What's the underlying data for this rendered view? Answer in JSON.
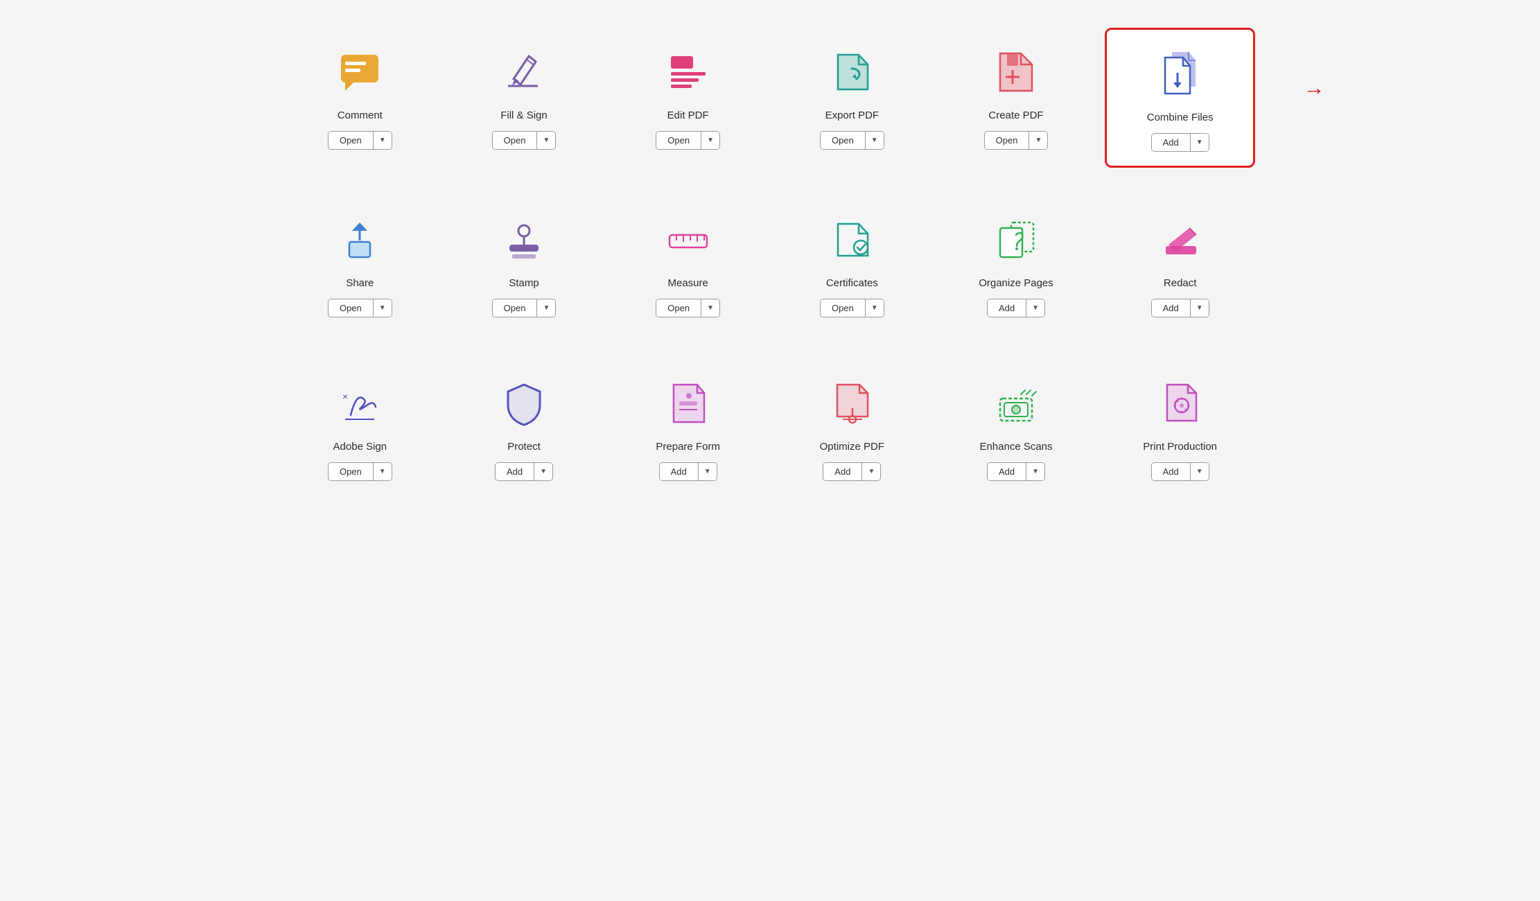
{
  "tools": [
    {
      "id": "comment",
      "label": "Comment",
      "button": "Open",
      "highlighted": false,
      "color": "#e8a020",
      "icon": "comment"
    },
    {
      "id": "fill-sign",
      "label": "Fill & Sign",
      "button": "Open",
      "highlighted": false,
      "color": "#7b5ea7",
      "icon": "fill-sign"
    },
    {
      "id": "edit-pdf",
      "label": "Edit PDF",
      "button": "Open",
      "highlighted": false,
      "color": "#e0407a",
      "icon": "edit-pdf"
    },
    {
      "id": "export-pdf",
      "label": "Export PDF",
      "button": "Open",
      "highlighted": false,
      "color": "#20a090",
      "icon": "export-pdf"
    },
    {
      "id": "create-pdf",
      "label": "Create PDF",
      "button": "Open",
      "highlighted": false,
      "color": "#e05060",
      "icon": "create-pdf"
    },
    {
      "id": "combine-files",
      "label": "Combine Files",
      "button": "Add",
      "highlighted": true,
      "color": "#4060c0",
      "icon": "combine-files"
    },
    {
      "id": "share",
      "label": "Share",
      "button": "Open",
      "highlighted": false,
      "color": "#4080d0",
      "icon": "share"
    },
    {
      "id": "stamp",
      "label": "Stamp",
      "button": "Open",
      "highlighted": false,
      "color": "#7b5ea7",
      "icon": "stamp"
    },
    {
      "id": "measure",
      "label": "Measure",
      "button": "Open",
      "highlighted": false,
      "color": "#e040a0",
      "icon": "measure"
    },
    {
      "id": "certificates",
      "label": "Certificates",
      "button": "Open",
      "highlighted": false,
      "color": "#20a090",
      "icon": "certificates"
    },
    {
      "id": "organize-pages",
      "label": "Organize Pages",
      "button": "Add",
      "highlighted": false,
      "color": "#30b050",
      "icon": "organize-pages"
    },
    {
      "id": "redact",
      "label": "Redact",
      "button": "Add",
      "highlighted": false,
      "color": "#e040a0",
      "icon": "redact"
    },
    {
      "id": "adobe-sign",
      "label": "Adobe Sign",
      "button": "Open",
      "highlighted": false,
      "color": "#5050c0",
      "icon": "adobe-sign"
    },
    {
      "id": "protect",
      "label": "Protect",
      "button": "Add",
      "highlighted": false,
      "color": "#5050c0",
      "icon": "protect"
    },
    {
      "id": "prepare-form",
      "label": "Prepare Form",
      "button": "Add",
      "highlighted": false,
      "color": "#c050c0",
      "icon": "prepare-form"
    },
    {
      "id": "optimize-pdf",
      "label": "Optimize PDF",
      "button": "Add",
      "highlighted": false,
      "color": "#e05060",
      "icon": "optimize-pdf"
    },
    {
      "id": "enhance-scans",
      "label": "Enhance Scans",
      "button": "Add",
      "highlighted": false,
      "color": "#30b050",
      "icon": "enhance-scans"
    },
    {
      "id": "print-production",
      "label": "Print Production",
      "button": "Add",
      "highlighted": false,
      "color": "#c050c0",
      "icon": "print-production"
    }
  ]
}
